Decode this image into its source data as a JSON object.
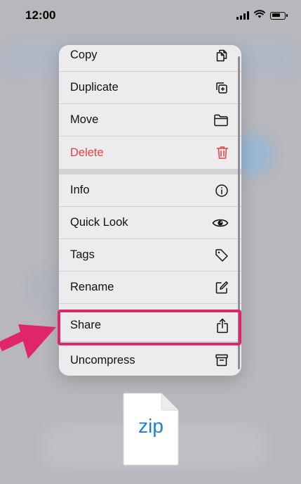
{
  "status_bar": {
    "time": "12:00"
  },
  "menu": {
    "items": [
      {
        "label": "Copy",
        "icon": "copy-icon"
      },
      {
        "label": "Duplicate",
        "icon": "duplicate-icon"
      },
      {
        "label": "Move",
        "icon": "folder-icon"
      },
      {
        "label": "Delete",
        "icon": "trash-icon",
        "destructive": true
      },
      {
        "label": "Info",
        "icon": "info-icon"
      },
      {
        "label": "Quick Look",
        "icon": "eye-icon"
      },
      {
        "label": "Tags",
        "icon": "tag-icon"
      },
      {
        "label": "Rename",
        "icon": "pencil-square-icon"
      },
      {
        "label": "Share",
        "icon": "share-icon",
        "highlighted": true
      },
      {
        "label": "Uncompress",
        "icon": "archive-box-icon"
      }
    ]
  },
  "file": {
    "label": "zip"
  },
  "colors": {
    "destructive": "#e8413c",
    "highlight": "#e0266a",
    "file_label": "#1d7fe0"
  }
}
